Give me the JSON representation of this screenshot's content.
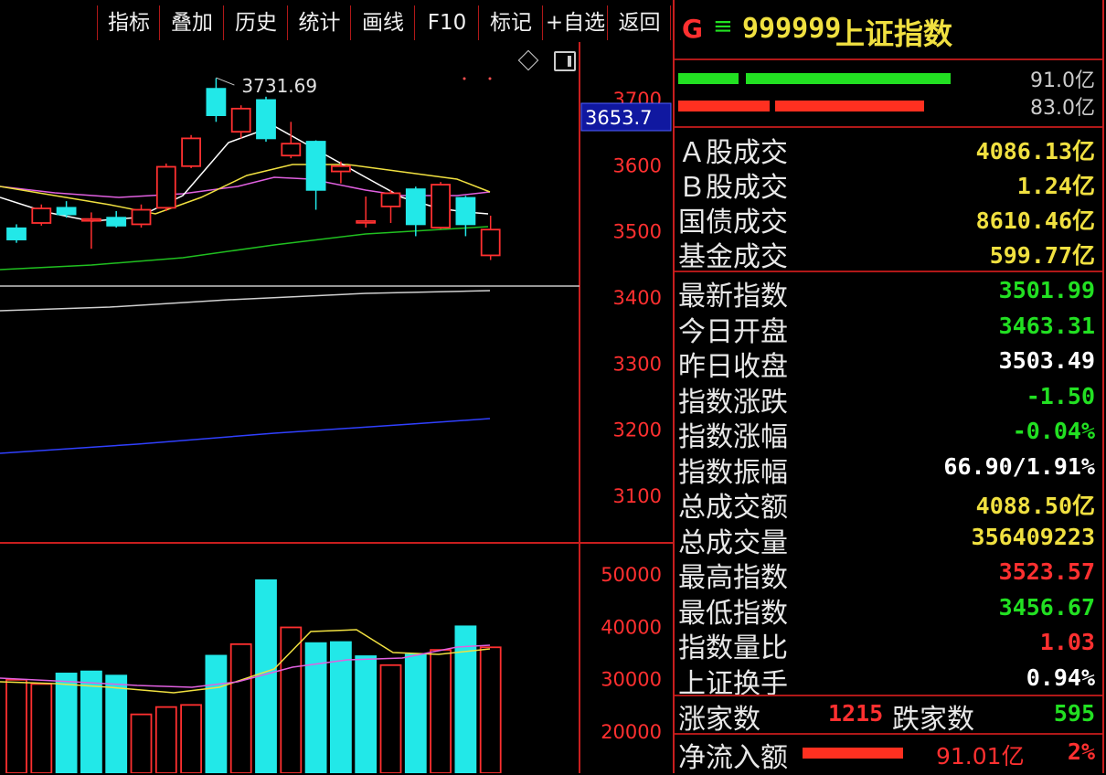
{
  "toolbar": {
    "items": [
      "指标",
      "叠加",
      "历史",
      "统计",
      "画线",
      "F10",
      "标记",
      "+自选",
      "返回"
    ]
  },
  "chart_icons": {
    "diamond": "diamond-icon",
    "panel": "panel-toggle-icon"
  },
  "header": {
    "g_label": "G",
    "menu_glyph": "≡",
    "code": "999999",
    "name": "上证指数"
  },
  "flow": {
    "buy_value": "91.0亿",
    "sell_value": "83.0亿",
    "buy_fraction": 0.91,
    "sell_fraction": 0.83
  },
  "turnover": [
    {
      "label": "Ａ股成交",
      "value": "4086.13亿"
    },
    {
      "label": "Ｂ股成交",
      "value": "1.24亿"
    },
    {
      "label": "国债成交",
      "value": "8610.46亿"
    },
    {
      "label": "基金成交",
      "value": "599.77亿"
    }
  ],
  "stats": [
    {
      "label": "最新指数",
      "value": "3501.99",
      "color": "#22e022"
    },
    {
      "label": "今日开盘",
      "value": "3463.31",
      "color": "#22e022"
    },
    {
      "label": "昨日收盘",
      "value": "3503.49",
      "color": "#ffffff"
    },
    {
      "label": "指数涨跌",
      "value": "-1.50",
      "color": "#22e022"
    },
    {
      "label": "指数涨幅",
      "value": "-0.04%",
      "color": "#22e022"
    },
    {
      "label": "指数振幅",
      "value": "66.90/1.91%",
      "color": "#ffffff"
    },
    {
      "label": "总成交额",
      "value": "4088.50亿",
      "color": "#f0e040"
    },
    {
      "label": "总成交量",
      "value": "356409223",
      "color": "#f0e040"
    },
    {
      "label": "最高指数",
      "value": "3523.57",
      "color": "#ff3030"
    },
    {
      "label": "最低指数",
      "value": "3456.67",
      "color": "#22e022"
    },
    {
      "label": "指数量比",
      "value": "1.03",
      "color": "#ff3030"
    },
    {
      "label": "上证换手",
      "value": "0.94%",
      "color": "#ffffff"
    }
  ],
  "breadth": {
    "up_label": "涨家数",
    "up_value": "1215",
    "down_label": "跌家数",
    "down_value": "595"
  },
  "netflow": {
    "label": "净流入额",
    "value": "91.01亿",
    "pct": "2%"
  },
  "colors": {
    "up": "#ff3030",
    "down": "#22e8e8",
    "ma5": "#ffffff",
    "ma10": "#f0e040",
    "ma20": "#e060e0",
    "ma60": "#20c020",
    "ma120": "#d0d0d0",
    "ma250": "#3040ff"
  },
  "chart_data": [
    {
      "type": "candlestick",
      "title": "",
      "y_ticks": [
        3700,
        3600,
        3500,
        3400,
        3300,
        3200,
        3100
      ],
      "ylim": [
        3050,
        3760
      ],
      "current_price_marker": "3653.7",
      "annotation": "3731.69",
      "candles": [
        {
          "o": 3504,
          "c": 3487,
          "h": 3510,
          "l": 3482
        },
        {
          "o": 3512,
          "c": 3534,
          "h": 3540,
          "l": 3508
        },
        {
          "o": 3535,
          "c": 3525,
          "h": 3545,
          "l": 3520
        },
        {
          "o": 3518,
          "c": 3518,
          "h": 3528,
          "l": 3473
        },
        {
          "o": 3520,
          "c": 3508,
          "h": 3530,
          "l": 3505
        },
        {
          "o": 3510,
          "c": 3532,
          "h": 3540,
          "l": 3505
        },
        {
          "o": 3535,
          "c": 3597,
          "h": 3602,
          "l": 3530
        },
        {
          "o": 3598,
          "c": 3640,
          "h": 3645,
          "l": 3595
        },
        {
          "o": 3715,
          "c": 3675,
          "h": 3731,
          "l": 3665
        },
        {
          "o": 3650,
          "c": 3685,
          "h": 3690,
          "l": 3640
        },
        {
          "o": 3698,
          "c": 3640,
          "h": 3703,
          "l": 3635
        },
        {
          "o": 3614,
          "c": 3632,
          "h": 3665,
          "l": 3610
        },
        {
          "o": 3635,
          "c": 3562,
          "h": 3637,
          "l": 3532
        },
        {
          "o": 3590,
          "c": 3598,
          "h": 3605,
          "l": 3572
        },
        {
          "o": 3515,
          "c": 3515,
          "h": 3552,
          "l": 3505
        },
        {
          "o": 3537,
          "c": 3557,
          "h": 3562,
          "l": 3512
        },
        {
          "o": 3563,
          "c": 3510,
          "h": 3567,
          "l": 3492
        },
        {
          "o": 3505,
          "c": 3570,
          "h": 3574,
          "l": 3503
        },
        {
          "o": 3550,
          "c": 3510,
          "h": 3553,
          "l": 3492
        },
        {
          "o": 3463,
          "c": 3502,
          "h": 3523,
          "l": 3456
        }
      ]
    },
    {
      "type": "bar",
      "title": "",
      "y_ticks": [
        50000,
        40000,
        30000,
        20000
      ],
      "ylim": [
        13500,
        52500
      ],
      "values": [
        29800,
        29000,
        31000,
        31400,
        30600,
        23200,
        24600,
        25000,
        34400,
        36600,
        48800,
        39800,
        36800,
        37000,
        34300,
        32600,
        34600,
        35500,
        40000,
        36000
      ],
      "up_down": [
        "u",
        "u",
        "d",
        "d",
        "d",
        "u",
        "u",
        "u",
        "d",
        "u",
        "d",
        "u",
        "d",
        "d",
        "d",
        "u",
        "d",
        "u",
        "d",
        "u"
      ]
    }
  ]
}
